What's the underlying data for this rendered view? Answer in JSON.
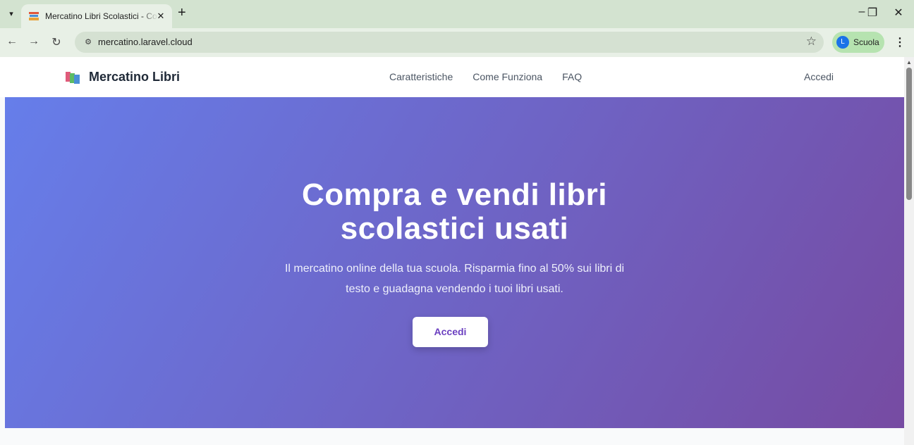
{
  "browser": {
    "tab_title": "Mercatino Libri Scolastici - Compra",
    "url": "mercatino.laravel.cloud",
    "profile_initial": "L",
    "profile_name": "Scuola"
  },
  "navbar": {
    "brand": "Mercatino Libri",
    "links": [
      "Caratteristiche",
      "Come Funziona",
      "FAQ"
    ],
    "login": "Accedi"
  },
  "hero": {
    "title_line1": "Compra e vendi libri",
    "title_line2": "scolastici usati",
    "subtitle_line1": "Il mercatino online della tua scuola. Risparmia fino al 50% sui libri di",
    "subtitle_line2": "testo e guadagna vendendo i tuoi libri usati.",
    "cta": "Accedi",
    "gradient_start": "#667eea",
    "gradient_end": "#764ba2"
  }
}
